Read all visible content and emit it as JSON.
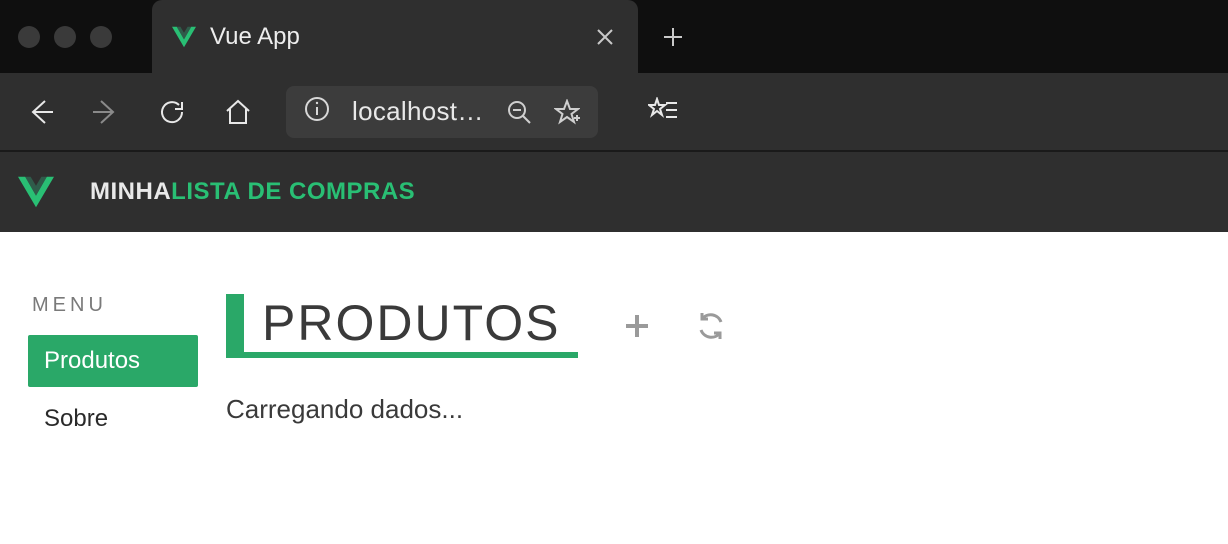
{
  "browser": {
    "tabTitle": "Vue App",
    "url": "localhost…"
  },
  "appbar": {
    "brand_white": "MINHA",
    "brand_green": "LISTA DE COMPRAS"
  },
  "sidebar": {
    "menuLabel": "MENU",
    "items": [
      {
        "label": "Produtos",
        "active": true
      },
      {
        "label": "Sobre",
        "active": false
      }
    ]
  },
  "content": {
    "title": "PRODUTOS",
    "loading_text": "Carregando dados..."
  }
}
